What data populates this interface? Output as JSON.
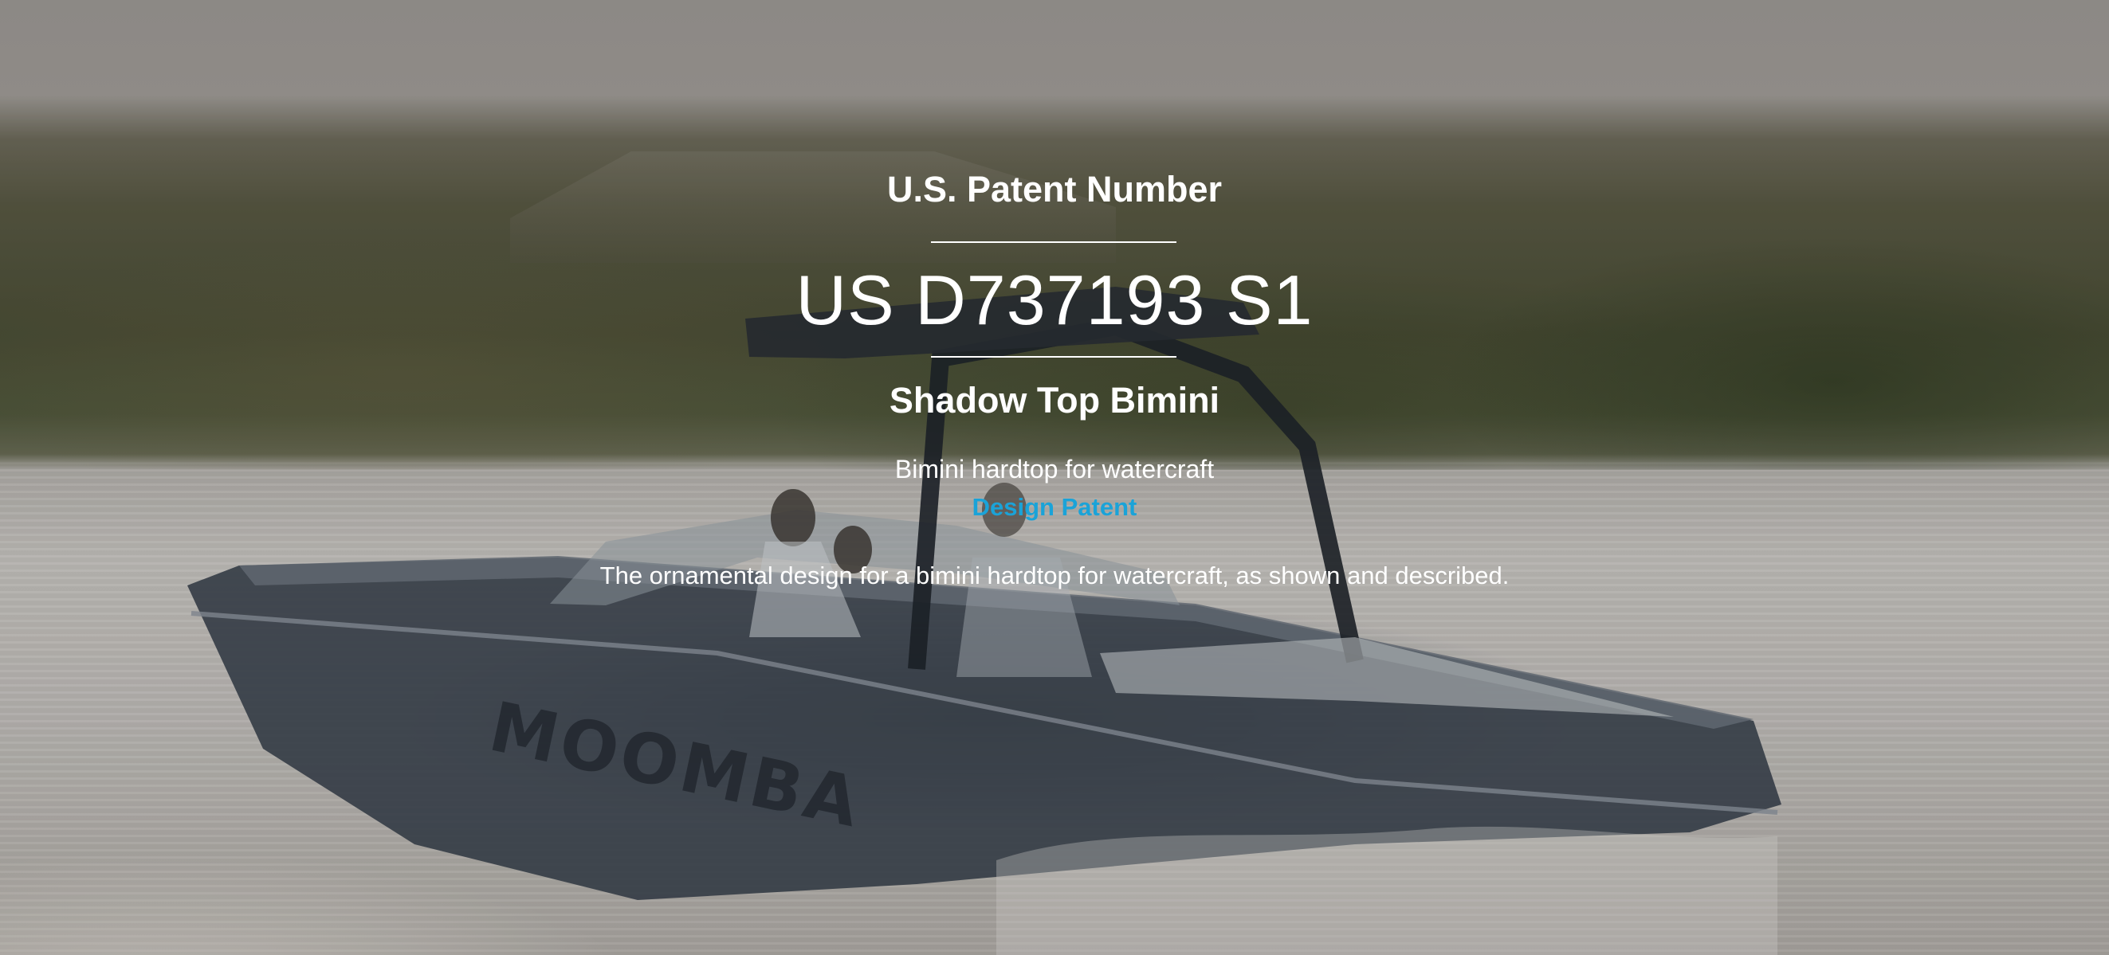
{
  "hero": {
    "label": "U.S. Patent Number",
    "patent_number": "US D737193 S1",
    "product_name": "Shadow Top Bimini",
    "subtitle": "Bimini hardtop for watercraft",
    "patent_type": "Design Patent",
    "claim": "The ornamental design for a bimini hardtop for watercraft, as shown and described."
  },
  "background": {
    "subject": "wakeboard boat on lake at sunset",
    "boat_hull_lettering": "MOOMBA"
  },
  "colors": {
    "text": "#ffffff",
    "link": "#1aa3d8"
  }
}
